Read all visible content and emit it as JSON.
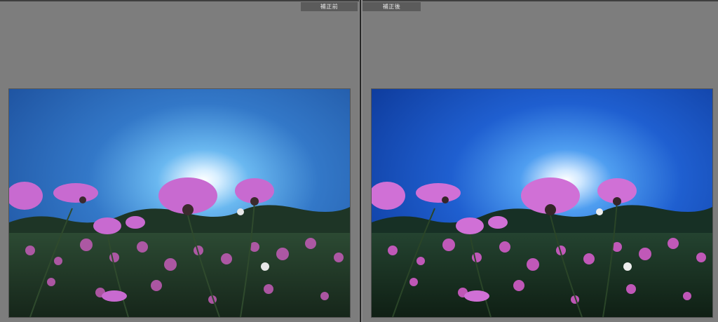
{
  "panes": {
    "before": {
      "label": "補正前"
    },
    "after": {
      "label": "補正後"
    }
  },
  "photo": {
    "subject": "cosmos-flowers-backlit",
    "before_sky_color": "#2f6fc4",
    "after_sky_color": "#1646b4"
  }
}
